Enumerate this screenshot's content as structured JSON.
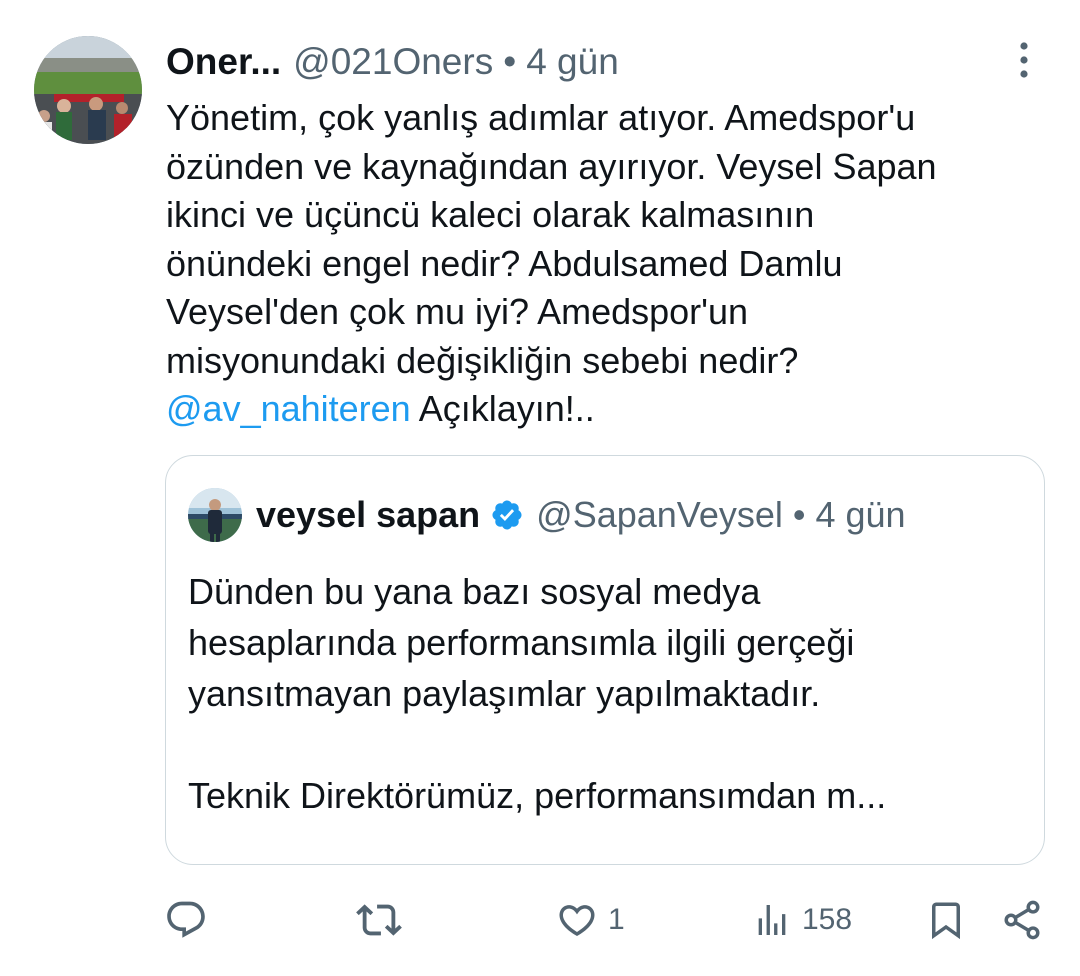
{
  "tweet": {
    "author_name": "Oner...",
    "author_handle": "@021Oners",
    "separator": "•",
    "time": "4 gün",
    "lines": [
      "Yönetim, çok yanlış adımlar atıyor. Amedspor'u",
      "özünden ve kaynağından ayırıyor. Veysel Sapan",
      "ikinci ve üçüncü kaleci olarak kalmasının",
      "önündeki engel nedir? Abdulsamed Damlu",
      "Veysel'den çok mu iyi? Amedspor'un",
      "misyonundaki değişikliğin sebebi nedir?"
    ],
    "mention": "@av_nahiteren",
    "last_line_text": " Açıklayın!.."
  },
  "quoted": {
    "author_name": "veysel sapan",
    "author_handle": "@SapanVeysel",
    "separator": "•",
    "time": "4 gün",
    "verified_icon": "verified-badge-icon",
    "paragraph1": [
      "Dünden bu yana bazı sosyal medya",
      "hesaplarında performansımla ilgili gerçeği",
      "yansıtmayan paylaşımlar yapılmaktadır."
    ],
    "paragraph2": "Teknik Direktörümüz, performansımdan m..."
  },
  "actions": {
    "reply_icon": "reply-icon",
    "retweet_icon": "retweet-icon",
    "like_icon": "heart-icon",
    "like_count": "1",
    "views_icon": "views-icon",
    "views_count": "158",
    "bookmark_icon": "bookmark-icon",
    "share_icon": "share-icon"
  },
  "colors": {
    "text": "#0f1419",
    "secondary": "#536471",
    "link": "#1d9bf0",
    "border": "#cfd9de",
    "verified": "#1d9bf0"
  }
}
